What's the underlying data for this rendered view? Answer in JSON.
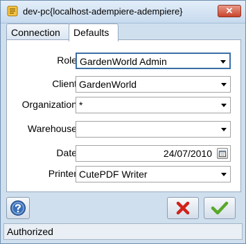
{
  "window": {
    "title": "dev-pc{localhost-adempiere-adempiere}",
    "close_symbol": "✕"
  },
  "tabs": [
    {
      "label": "Connection",
      "active": false
    },
    {
      "label": "Defaults",
      "active": true
    }
  ],
  "fields": {
    "role": {
      "label": "Role",
      "value": "GardenWorld Admin"
    },
    "client": {
      "label": "Client",
      "value": "GardenWorld"
    },
    "organization": {
      "label": "Organization",
      "value": "*"
    },
    "warehouse": {
      "label": "Warehouse",
      "value": ""
    },
    "date": {
      "label": "Date",
      "value": "24/07/2010"
    },
    "printer": {
      "label": "Printer",
      "value": "CutePDF Writer"
    }
  },
  "icons": {
    "app": "app-icon",
    "help": "help-icon",
    "cancel": "cancel-x-icon",
    "ok": "ok-checkmark-icon",
    "calendar": "calendar-icon"
  },
  "colors": {
    "window_bg": "#cfdfee",
    "focus_border": "#3b6ea5",
    "cancel_red": "#d0221b",
    "ok_green": "#5aa82a"
  },
  "status": {
    "text": "Authorized"
  }
}
